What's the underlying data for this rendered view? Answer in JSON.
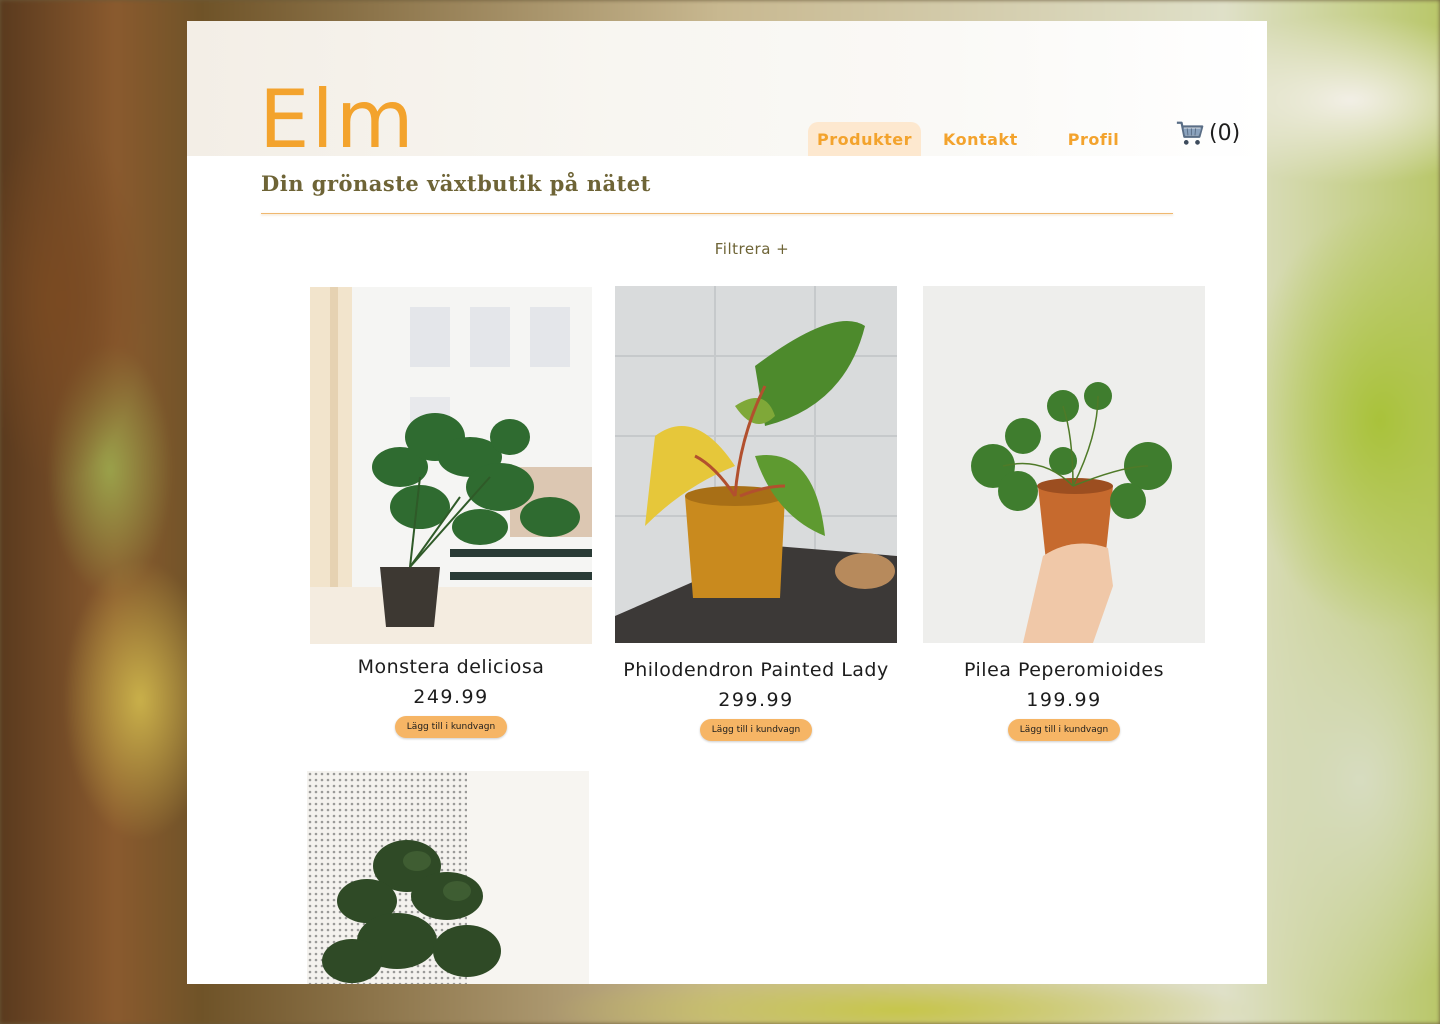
{
  "brand": {
    "logo": "Elm",
    "tagline": "Din grönaste växtbutik på nätet"
  },
  "nav": {
    "items": [
      {
        "label": "Produkter",
        "active": true
      },
      {
        "label": "Kontakt",
        "active": false
      },
      {
        "label": "Profil",
        "active": false
      }
    ]
  },
  "cart": {
    "icon": "shopping-cart-icon",
    "count": "(0)"
  },
  "filter": {
    "label": "Filtrera +"
  },
  "products": [
    {
      "name": "Monstera deliciosa",
      "price": "249.99",
      "button": "Lägg till i kundvagn"
    },
    {
      "name": "Philodendron Painted Lady",
      "price": "299.99",
      "button": "Lägg till i kundvagn"
    },
    {
      "name": "Pilea Peperomioides",
      "price": "199.99",
      "button": "Lägg till i kundvagn"
    },
    {
      "name": "",
      "price": "",
      "button": ""
    }
  ],
  "colors": {
    "accent": "#f3a32d",
    "tagline": "#6e6436",
    "button": "#f6b565",
    "nav_active_bg": "#fde8cf"
  }
}
